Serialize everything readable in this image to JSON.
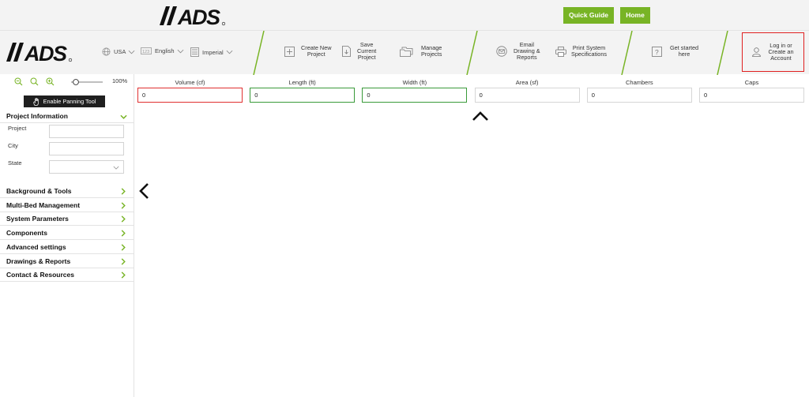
{
  "top": {
    "logo_text": "//ADS",
    "quick_guide": "Quick Guide",
    "home": "Home"
  },
  "nav": {
    "logo_text": "//ADS",
    "country": "USA",
    "language": "English",
    "units": "Imperial",
    "create_new_project": "Create New\nProject",
    "save_current_project": "Save\nCurrent\nProject",
    "manage_projects": "Manage\nProjects",
    "email_drawing_reports": "Email\nDrawing &\nReports",
    "print_system_specs": "Print System\nSpecifications",
    "get_started": "Get started\nhere",
    "login": "Log in or\nCreate an\nAccount"
  },
  "sidebar": {
    "zoom_percent": "100%",
    "pan_tool": "Enable Panning Tool",
    "project_info": {
      "title": "Project Information",
      "project_label": "Project",
      "project_value": "",
      "city_label": "City",
      "city_value": "",
      "state_label": "State",
      "state_value": ""
    },
    "sections": [
      "Background & Tools",
      "Multi-Bed Management",
      "System Parameters",
      "Components",
      "Advanced settings",
      "Drawings & Reports",
      "Contact & Resources"
    ]
  },
  "metrics": [
    {
      "label": "Volume (cf)",
      "value": "0",
      "state": "error"
    },
    {
      "label": "Length (ft)",
      "value": "0",
      "state": "valid"
    },
    {
      "label": "Width (ft)",
      "value": "0",
      "state": "valid"
    },
    {
      "label": "Area (sf)",
      "value": "0",
      "state": "normal"
    },
    {
      "label": "Chambers",
      "value": "0",
      "state": "normal"
    },
    {
      "label": "Caps",
      "value": "0",
      "state": "normal"
    }
  ],
  "colors": {
    "accent_green": "#78b425",
    "error_red": "#e03030",
    "valid_green": "#3a9a3a"
  },
  "icons": [
    "globe-icon",
    "language-icon",
    "calculator-icon",
    "plus-icon",
    "save-icon",
    "folder-icon",
    "email-icon",
    "print-icon",
    "help-icon",
    "user-icon",
    "zoom-in-icon",
    "zoom-out-icon",
    "hand-icon",
    "collapse-up-icon",
    "collapse-left-icon"
  ]
}
